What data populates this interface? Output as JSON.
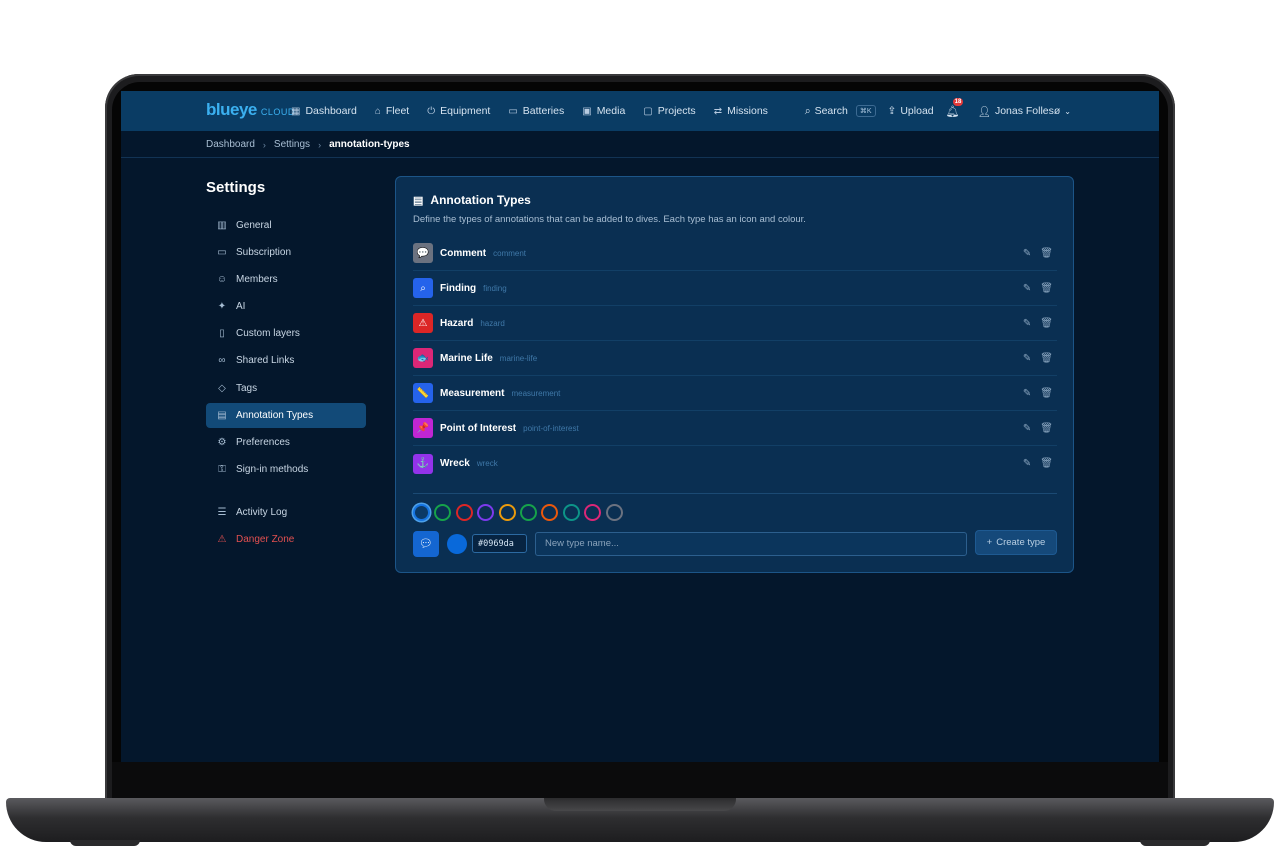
{
  "nav": {
    "logo": "blueye",
    "logo_sub": "CLOUD",
    "links": [
      {
        "label": "Dashboard",
        "icon": "grid-icon"
      },
      {
        "label": "Fleet",
        "icon": "fleet-icon"
      },
      {
        "label": "Equipment",
        "icon": "equipment-icon"
      },
      {
        "label": "Batteries",
        "icon": "battery-icon"
      },
      {
        "label": "Media",
        "icon": "media-icon"
      },
      {
        "label": "Projects",
        "icon": "folder-icon"
      },
      {
        "label": "Missions",
        "icon": "missions-icon"
      }
    ],
    "search_label": "Search",
    "search_shortcut": "⌘K",
    "upload_label": "Upload",
    "notifications_count": "18",
    "user_name": "Jonas Follesø"
  },
  "breadcrumb": [
    "Dashboard",
    "Settings",
    "annotation-types"
  ],
  "sidebar": {
    "title": "Settings",
    "items": [
      {
        "label": "General",
        "icon": "building-icon"
      },
      {
        "label": "Subscription",
        "icon": "card-icon"
      },
      {
        "label": "Members",
        "icon": "users-icon"
      },
      {
        "label": "AI",
        "icon": "sparkles-icon"
      },
      {
        "label": "Custom layers",
        "icon": "map-icon"
      },
      {
        "label": "Shared Links",
        "icon": "link-icon"
      },
      {
        "label": "Tags",
        "icon": "tag-icon"
      },
      {
        "label": "Annotation Types",
        "icon": "annotation-icon",
        "active": true
      },
      {
        "label": "Preferences",
        "icon": "gear-icon"
      },
      {
        "label": "Sign-in methods",
        "icon": "key-icon"
      }
    ],
    "secondary": [
      {
        "label": "Activity Log",
        "icon": "log-icon"
      },
      {
        "label": "Danger Zone",
        "icon": "warning-icon",
        "danger": true
      }
    ]
  },
  "card": {
    "title": "Annotation Types",
    "description": "Define the types of annotations that can be added to dives. Each type has an icon and colour.",
    "types": [
      {
        "name": "Comment",
        "slug": "comment",
        "color": "#6b7280",
        "icon": "comment-icon",
        "glyph": "💬"
      },
      {
        "name": "Finding",
        "slug": "finding",
        "color": "#2563eb",
        "icon": "search-icon",
        "glyph": "⌕"
      },
      {
        "name": "Hazard",
        "slug": "hazard",
        "color": "#dc2626",
        "icon": "warning-icon",
        "glyph": "⚠"
      },
      {
        "name": "Marine Life",
        "slug": "marine-life",
        "color": "#db2777",
        "icon": "fish-icon",
        "glyph": "🐟"
      },
      {
        "name": "Measurement",
        "slug": "measurement",
        "color": "#2563eb",
        "icon": "ruler-icon",
        "glyph": "📏"
      },
      {
        "name": "Point of Interest",
        "slug": "point-of-interest",
        "color": "#c026d3",
        "icon": "pin-icon",
        "glyph": "📌"
      },
      {
        "name": "Wreck",
        "slug": "wreck",
        "color": "#9333ea",
        "icon": "anchor-icon",
        "glyph": "⚓"
      }
    ],
    "swatches": [
      "#1674e0",
      "#16a34a",
      "#dc2626",
      "#7c3aed",
      "#ea9a0c",
      "#16a34a",
      "#ea580c",
      "#0d9488",
      "#db2777",
      "#6b7280"
    ],
    "new_type": {
      "icon": "comment-icon",
      "color": "#0969da",
      "hex_value": "#0969da",
      "name_placeholder": "New type name...",
      "create_label": "Create type"
    }
  }
}
